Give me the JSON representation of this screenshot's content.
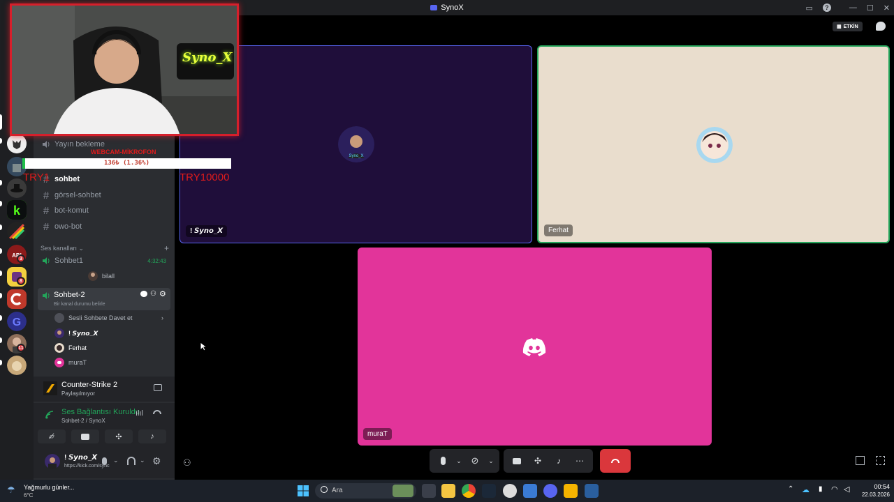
{
  "window": {
    "title": "SynoX"
  },
  "topbar": {
    "status_label": "ETKİN"
  },
  "overlay": {
    "webcam_label": "WEBCAM-MİKROFON",
    "sign_text": "Syno_X",
    "goal_text": "136₺ (1.36%)",
    "goal_progress": 0.0136,
    "try_text": "TRY10000",
    "try_partial": "TRY1"
  },
  "channels": {
    "yayin": "Yayın bekleme",
    "sohbet": "sohbet",
    "gorsel": "görsel-sohbet",
    "bot": "bot-komut",
    "owo": "owo-bot"
  },
  "voice_section": {
    "title": "Ses kanalları",
    "chevron": "⌄",
    "add": "+"
  },
  "voice_channels": {
    "sohbet1": {
      "name": "Sohbet1",
      "timer": "4:32:43",
      "member": "bilall"
    },
    "sohbet2": {
      "name": "Sohbet-2",
      "status": "Bir kanal durumu belirle",
      "invite": "Sesli Sohbete Davet et",
      "members": [
        "! 𝙎𝙮𝙣𝙤_𝙓",
        "Ferhat",
        "muraT"
      ]
    }
  },
  "server_badges": {
    "b1": "3",
    "b2": "8",
    "b3": "11"
  },
  "activity": {
    "game": "Counter-Strike 2",
    "status": "Paylaşılmıyor"
  },
  "voice_panel": {
    "status": "Ses Bağlantısı Kuruldu",
    "location": "Sohbet-2 / SynoX"
  },
  "user_panel": {
    "name": "! 𝙎𝙮𝙣𝙤_𝙓",
    "status": "https://kick.com/sync"
  },
  "tiles": {
    "syno": {
      "name": "! 𝙎𝙮𝙣𝙤_𝙓",
      "bg": "#1f0e3a"
    },
    "ferhat": {
      "name": "Ferhat",
      "bg": "#e9ddcd"
    },
    "murat": {
      "name": "muraT",
      "bg": "#e2349a"
    }
  },
  "taskbar": {
    "weather_title": "Yağmurlu günler...",
    "weather_temp": "6°C",
    "search_placeholder": "Ara",
    "time": "00:54",
    "date": "22.03.2026"
  },
  "colors": {
    "accent_green": "#23a55a",
    "hangup_red": "#da373c",
    "blurple": "#5865f2"
  }
}
